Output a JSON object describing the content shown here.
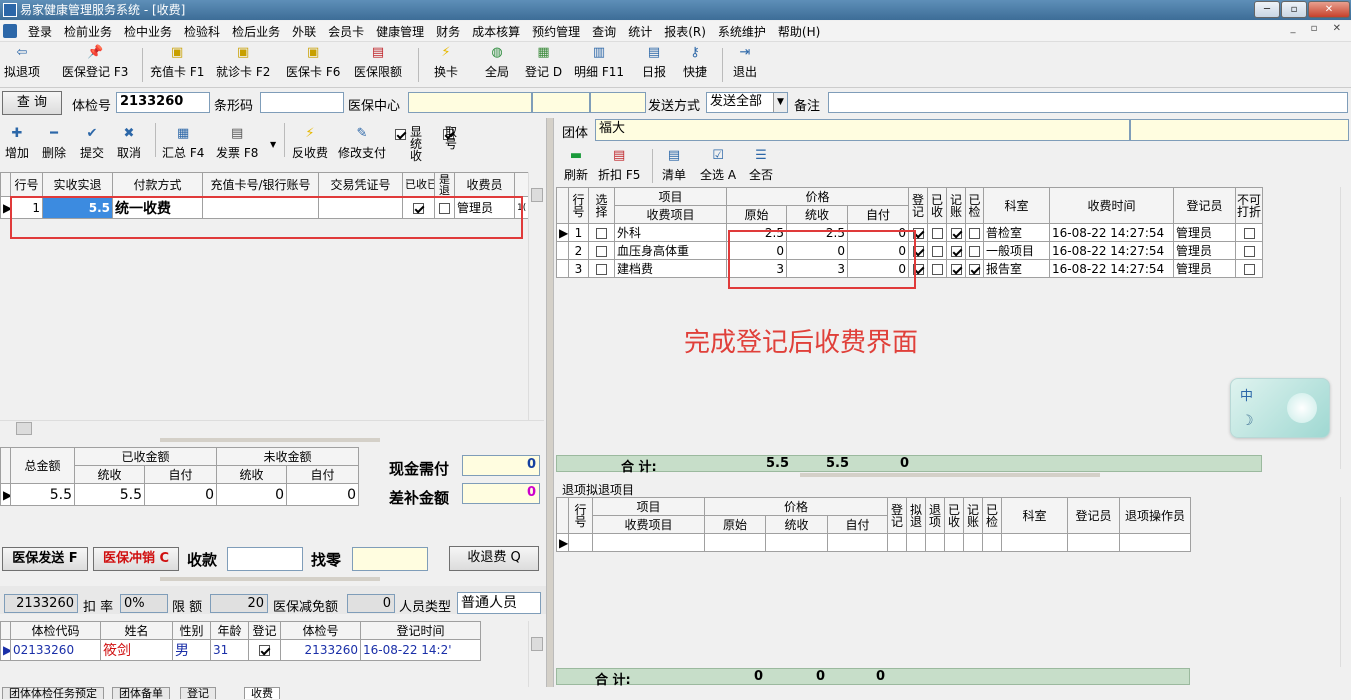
{
  "window": {
    "title": "易家健康管理服务系统 - [收费]"
  },
  "menu": [
    "登录",
    "检前业务",
    "检中业务",
    "检验科",
    "检后业务",
    "外联",
    "会员卡",
    "健康管理",
    "财务",
    "成本核算",
    "预约管理",
    "查询",
    "统计",
    "报表(R)",
    "系统维护",
    "帮助(H)"
  ],
  "toolbar": {
    "items": [
      {
        "label": "拟退项",
        "icon": "undo-icon"
      },
      {
        "label": "医保登记 F3",
        "icon": "pin-icon"
      },
      {
        "label": "充值卡 F1",
        "icon": "card-icon"
      },
      {
        "label": "就诊卡 F2",
        "icon": "card-icon"
      },
      {
        "label": "医保卡 F6",
        "icon": "card-icon"
      },
      {
        "label": "医保限额",
        "icon": "limit-icon"
      },
      {
        "label": "换卡",
        "icon": "lightning-icon"
      },
      {
        "label": "全局",
        "icon": "globe-icon"
      },
      {
        "label": "登记 D",
        "icon": "register-icon"
      },
      {
        "label": "明细 F11",
        "icon": "table-icon"
      },
      {
        "label": "日报",
        "icon": "report-icon"
      },
      {
        "label": "快捷",
        "icon": "key-icon"
      },
      {
        "label": "退出",
        "icon": "exit-icon"
      }
    ]
  },
  "search": {
    "query_button": "查 询",
    "exam_no_label": "体检号",
    "exam_no": "2133260",
    "barcode_label": "条形码",
    "barcode": "",
    "insurance_center_label": "医保中心",
    "send_mode_label": "发送方式",
    "send_mode": "发送全部",
    "remark_label": "备注",
    "remark": ""
  },
  "pay_toolbar": {
    "add": "增加",
    "delete": "删除",
    "submit": "提交",
    "cancel": "取消",
    "summary": "汇总 F4",
    "invoice": "发票 F8",
    "reverse": "反收费",
    "modify_pay": "修改支付",
    "show_settled_label": "显统收",
    "take_no_label": "取号"
  },
  "payment_table": {
    "headers": [
      "行号",
      "实收实退",
      "付款方式",
      "充值卡号/银行账号",
      "交易凭证号",
      "已收已退",
      "是退",
      "收费员",
      ""
    ],
    "rows": [
      {
        "no": "1",
        "amount": "5.5",
        "method": "统一收费",
        "card": "",
        "voucher": "",
        "received": true,
        "refund": false,
        "cashier": "管理员",
        "extra": "1("
      }
    ]
  },
  "totals": {
    "total_label": "总金额",
    "paid_label": "已收金额",
    "unpaid_label": "未收金额",
    "settled_label": "统收",
    "self_label": "自付",
    "total": "5.5",
    "paid_settled": "5.5",
    "paid_self": "0",
    "unpaid_settled": "0",
    "unpaid_self": "0"
  },
  "cash": {
    "due_label": "现金需付",
    "due": "0",
    "diff_label": "差补金额",
    "diff": "0"
  },
  "actions": {
    "send_insurance": "医保发送 F",
    "cancel_insurance": "医保冲销 C",
    "collect_label": "收款",
    "collect": "",
    "change_label": "找零",
    "change": "",
    "collect_button": "收退费 Q"
  },
  "person_info": {
    "exam_no": "2133260",
    "discount_label": "扣 率",
    "discount": "0%",
    "limit_label": "限 额",
    "limit": "20",
    "reduce_label": "医保减免额",
    "reduce": "0",
    "person_type_label": "人员类型",
    "person_type": "普通人员"
  },
  "person_table": {
    "headers": [
      "体检代码",
      "姓名",
      "性别",
      "年龄",
      "登记",
      "体检号",
      "登记时间"
    ],
    "rows": [
      {
        "code": "02133260",
        "name": "筱剑",
        "gender": "男",
        "age": "31",
        "registered": true,
        "exam_no": "2133260",
        "time": "16-08-22 14:2'"
      }
    ]
  },
  "group": {
    "label": "团体",
    "value": "福大"
  },
  "items_toolbar": {
    "refresh": "刷新",
    "discount": "折扣 F5",
    "list": "清单",
    "select_all": "全选 A",
    "select_none": "全否"
  },
  "items_table": {
    "h_row": "行号",
    "h_select": "选择",
    "h_item": "项目",
    "h_item_sub": "收费项目",
    "h_price": "价格",
    "h_orig": "原始",
    "h_settled": "统收",
    "h_self": "自付",
    "h_reg": "登记",
    "h_recv": "已收",
    "h_acct": "记账",
    "h_checked": "已检",
    "h_dept": "科室",
    "h_time": "收费时间",
    "h_clerk": "登记员",
    "h_nodisc": "不可打折",
    "rows": [
      {
        "no": "1",
        "name": "外科",
        "orig": "2.5",
        "settled": "2.5",
        "self": "0",
        "reg": true,
        "recv": false,
        "acct": true,
        "checked": false,
        "dept": "普检室",
        "time": "16-08-22 14:27:54",
        "clerk": "管理员",
        "nodisc": false
      },
      {
        "no": "2",
        "name": "血压身高体重",
        "orig": "0",
        "settled": "0",
        "self": "0",
        "reg": true,
        "recv": false,
        "acct": true,
        "checked": false,
        "dept": "一般项目",
        "time": "16-08-22 14:27:54",
        "clerk": "管理员",
        "nodisc": false
      },
      {
        "no": "3",
        "name": "建档费",
        "orig": "3",
        "settled": "3",
        "self": "0",
        "reg": true,
        "recv": false,
        "acct": true,
        "checked": true,
        "dept": "报告室",
        "time": "16-08-22 14:27:54",
        "clerk": "管理员",
        "nodisc": false
      }
    ],
    "total_label": "合 计:",
    "total_orig": "5.5",
    "total_settled": "5.5",
    "total_self": "0"
  },
  "annotation": "完成登记后收费界面",
  "refund_section": {
    "title": "退项拟退项目",
    "h_row": "行号",
    "h_item": "项目",
    "h_item_sub": "收费项目",
    "h_price": "价格",
    "h_orig": "原始",
    "h_settled": "统收",
    "h_self": "自付",
    "h_reg": "登记",
    "h_pending": "拟退",
    "h_refund": "退项",
    "h_recv": "已收",
    "h_acct": "记账",
    "h_checked": "已检",
    "h_dept": "科室",
    "h_clerk": "登记员",
    "h_operator": "退项操作员",
    "total_label": "合 计:",
    "total_orig": "0",
    "total_settled": "0",
    "total_self": "0"
  },
  "widget": {
    "text": "中"
  },
  "bottom_tabs": [
    "团体体检任务预定",
    "团体备单",
    "登记",
    "收费"
  ],
  "colors": {
    "annotation": "#e0403a",
    "red_box": "#e03a3a",
    "total_bar": "#c7dec9",
    "highlight": "#3c8be0"
  }
}
